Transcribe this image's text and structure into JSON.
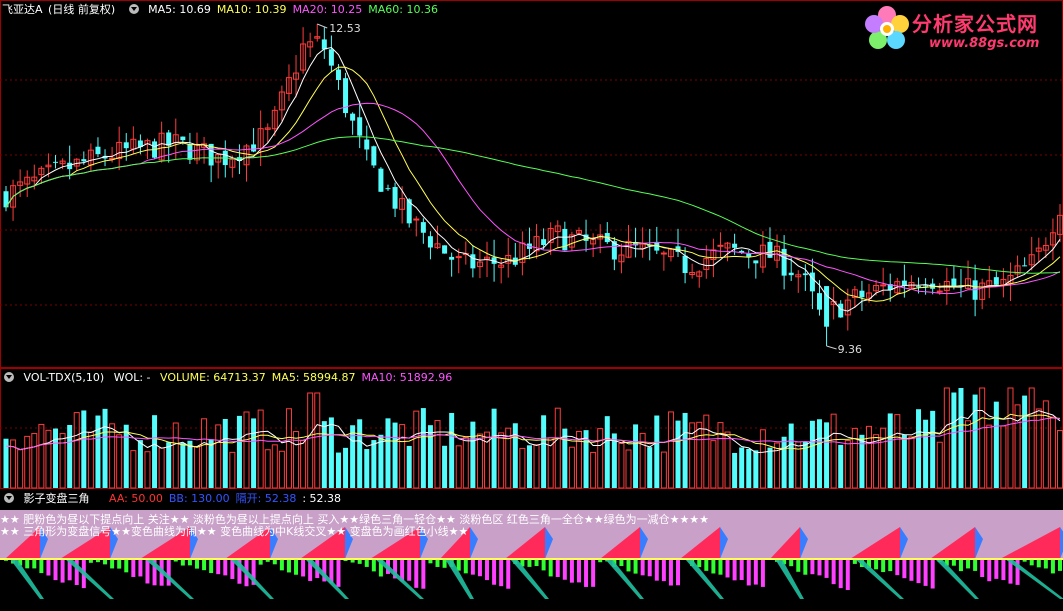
{
  "main_panel": {
    "stock_name": "飞亚达A",
    "mode": "(日线 前复权)",
    "ma_labels": [
      {
        "text": "MA5: 10.69",
        "color": "#ffffff"
      },
      {
        "text": "MA10: 10.39",
        "color": "#ffff55"
      },
      {
        "text": "MA20: 10.25",
        "color": "#ff55ff"
      },
      {
        "text": "MA60: 10.36",
        "color": "#55ff55"
      }
    ],
    "high_label": "12.53",
    "low_label": "9.36"
  },
  "vol_panel": {
    "name": "VOL-TDX(5,10)",
    "wol": "WOL: -",
    "labels": [
      {
        "text": "VOLUME: 64713.37",
        "color": "#ffff55"
      },
      {
        "text": "MA5: 58994.87",
        "color": "#ffff55"
      },
      {
        "text": "MA10: 51892.96",
        "color": "#ff55ff"
      }
    ]
  },
  "indicator_panel": {
    "name": "影子变盘三角",
    "labels": [
      {
        "text": "AA: 50.00",
        "color": "#ff3333"
      },
      {
        "text": "BB: 130.00",
        "color": "#3355ff"
      },
      {
        "text": "隔开: 52.38",
        "color": "#3355ff"
      },
      {
        "text": ": 52.38",
        "color": "#ffffff"
      }
    ],
    "desc_line1": "★★ 肥粉色为昼以下提点向上 关注★★ 淡粉色为昼以上提点向上 买入★★绿色三角一轻仓★★ 淡粉色区 红色三角一全仓★★绿色为一减仓★★★★",
    "desc_line2": "★★ 三角形为变盘信号★★变色曲线为闹★★ 变色曲线为中K线交叉★★ 变盘色为画红色小线★★"
  },
  "logo": {
    "text": "分析家公式网",
    "url": "www.88gs.com"
  },
  "colors": {
    "up": "#ff3c3c",
    "down": "#54fcfc",
    "ma5": "#ffffff",
    "ma10": "#ffff55",
    "ma20": "#ff55ff",
    "ma60": "#55ff55",
    "grid": "#7a0000"
  },
  "chart_data": {
    "type": "candlestick",
    "y_range": [
      9.36,
      12.53
    ],
    "annotations": [
      {
        "text": "12.53",
        "kind": "high"
      },
      {
        "text": "9.36",
        "kind": "low"
      }
    ]
  }
}
